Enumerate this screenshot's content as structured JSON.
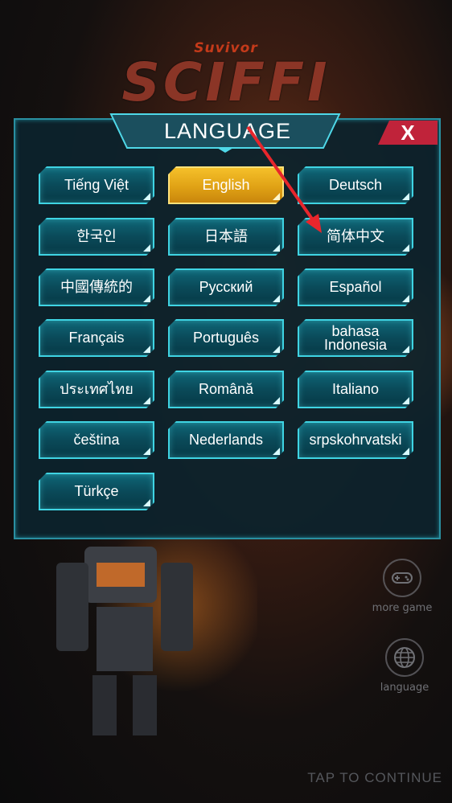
{
  "logo": {
    "subtitle": "Suvivor",
    "title": "SCIFFI"
  },
  "dialog": {
    "title": "LANGUAGE",
    "close_label": "X",
    "languages": [
      {
        "label": "Tiếng Việt",
        "selected": false
      },
      {
        "label": "English",
        "selected": true
      },
      {
        "label": "Deutsch",
        "selected": false
      },
      {
        "label": "한국인",
        "selected": false
      },
      {
        "label": "日本語",
        "selected": false
      },
      {
        "label": "简体中文",
        "selected": false
      },
      {
        "label": "中國傳統的",
        "selected": false
      },
      {
        "label": "Русский",
        "selected": false
      },
      {
        "label": "Español",
        "selected": false
      },
      {
        "label": "Français",
        "selected": false
      },
      {
        "label": "Português",
        "selected": false
      },
      {
        "label": "bahasa Indonesia",
        "selected": false
      },
      {
        "label": "ประเทศไทย",
        "selected": false
      },
      {
        "label": "Română",
        "selected": false
      },
      {
        "label": "Italiano",
        "selected": false
      },
      {
        "label": "čeština",
        "selected": false
      },
      {
        "label": "Nederlands",
        "selected": false
      },
      {
        "label": "srpskohrvatski",
        "selected": false
      },
      {
        "label": "Türkçe",
        "selected": false
      }
    ]
  },
  "side": {
    "more_game": "more game",
    "language": "language"
  },
  "footer": {
    "tap_to_continue": "TAP TO CONTINUE"
  },
  "colors": {
    "accent": "#3fd4e3",
    "selected": "#e0a215",
    "close": "#c0233a",
    "arrow": "#e8262c"
  },
  "icons": {
    "more_game": "gamepad-icon",
    "language": "globe-icon"
  }
}
